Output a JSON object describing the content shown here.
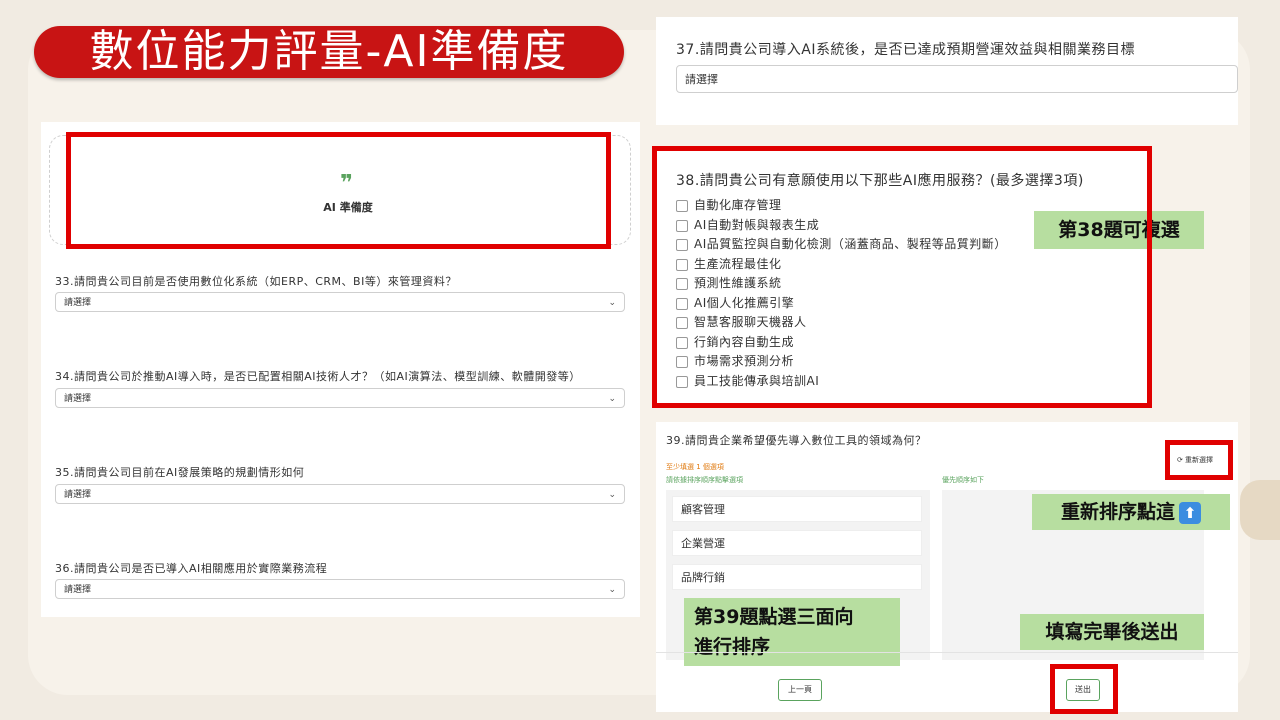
{
  "banner": {
    "title": "數位能力評量-AI準備度"
  },
  "left_panel": {
    "quote_mark": "❞",
    "section_title": "AI 準備度",
    "questions": [
      {
        "text": "33.請問貴公司目前是否使用數位化系統（如ERP、CRM、BI等）來管理資料？",
        "value": "請選擇"
      },
      {
        "text": "34.請問貴公司於推動AI導入時，是否已配置相關AI技術人才？（如AI演算法、模型訓練、軟體開發等）",
        "value": "請選擇"
      },
      {
        "text": "35.請問貴公司目前在AI發展策略的規劃情形如何",
        "value": "請選擇"
      },
      {
        "text": "36.請問貴公司是否已導入AI相關應用於實際業務流程",
        "value": "請選擇"
      }
    ],
    "chevron": "⌄"
  },
  "q37": {
    "text": "37.請問貴公司導入AI系統後，是否已達成預期營運效益與相關業務目標",
    "value": "請選擇"
  },
  "q38": {
    "text": "38.請問貴公司有意願使用以下那些AI應用服務？(最多選擇3項)",
    "options": [
      "自動化庫存管理",
      "AI自動對帳與報表生成",
      "AI品質監控與自動化檢測（涵蓋商品、製程等品質判斷）",
      "生產流程最佳化",
      "預測性維護系統",
      "AI個人化推薦引擎",
      "智慧客服聊天機器人",
      "行銷內容自動生成",
      "市場需求預測分析",
      "員工技能傳承與培訓AI"
    ],
    "note": "第38題可複選"
  },
  "q39": {
    "text": "39.請問貴企業希望優先導入數位工具的領域為何？",
    "min_note": "至少填選 1 個選項",
    "left_hint": "請依據排序順序點擊選項",
    "right_hint": "優先順序如下",
    "reset_label": "重新選擇",
    "items": [
      "顧客管理",
      "企業營運",
      "品牌行銷"
    ],
    "note_reset": "重新排序點這",
    "arrow_icon": "⬆",
    "note_order_line1": "第39題點選三面向",
    "note_order_line2": "進行排序",
    "note_submit": "填寫完畢後送出",
    "prev_label": "上一頁",
    "submit_label": "送出"
  }
}
